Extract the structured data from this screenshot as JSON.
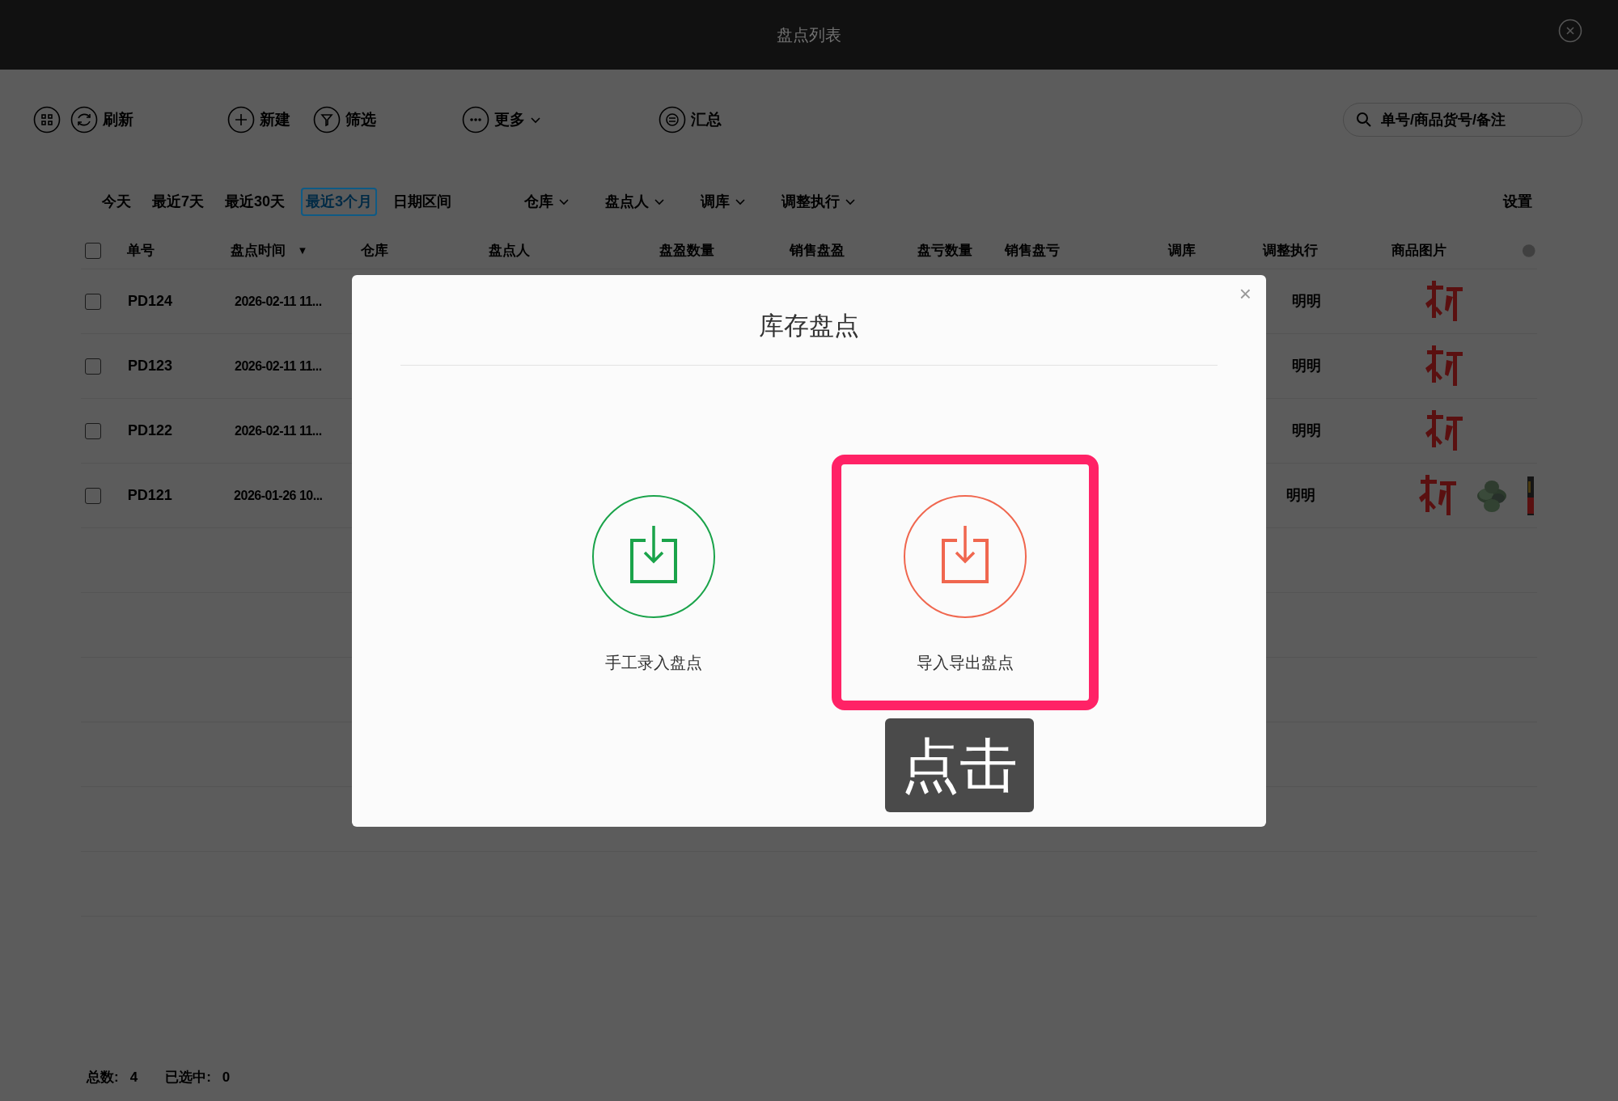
{
  "window": {
    "title": "盘点列表"
  },
  "toolbar": [
    {
      "dropdown": false
    },
    {
      "label": "刷新",
      "dropdown": false
    },
    {
      "label": "新建",
      "dropdown": false
    },
    {
      "label": "筛选",
      "dropdown": false
    },
    {
      "label": "更多",
      "dropdown": true
    },
    {
      "label": "汇总",
      "dropdown": false
    }
  ],
  "search": {
    "placeholder": "单号/商品货号/备注"
  },
  "date_filters": [
    {
      "label": "今天",
      "selected": false
    },
    {
      "label": "最近7天",
      "selected": false
    },
    {
      "label": "最近30天",
      "selected": false
    },
    {
      "label": "最近3个月",
      "selected": true
    },
    {
      "label": "日期区间",
      "selected": false
    }
  ],
  "dropdown_filters": [
    "仓库",
    "盘点人",
    "调库",
    "调整执行"
  ],
  "settings_link": "设置",
  "table": {
    "select_all": {
      "checked": false
    },
    "columns": [
      {
        "label": "单号"
      },
      {
        "label": "盘点时间",
        "sort": "▼"
      },
      {
        "label": "仓库"
      },
      {
        "label": "盘点人"
      },
      {
        "label": "盘盈数量"
      },
      {
        "label": "销售盘盈"
      },
      {
        "label": "盘亏数量"
      },
      {
        "label": "销售盘亏"
      },
      {
        "label": "调库"
      },
      {
        "label": "调整执行"
      },
      {
        "label": "商品图片"
      }
    ],
    "rows": [
      {
        "checked": false,
        "id": "PD124",
        "time": "2026-02-11 11...",
        "executor": "明明"
      },
      {
        "checked": false,
        "id": "PD123",
        "time": "2026-02-11 11...",
        "executor": "明明"
      },
      {
        "checked": false,
        "id": "PD122",
        "time": "2026-02-11 11...",
        "executor": "明明"
      },
      {
        "checked": false,
        "id": "PD121",
        "time": "2026-01-26 10...",
        "executor": "明明"
      }
    ]
  },
  "status_bar": {
    "total_label": "总数:",
    "total": "4",
    "selected_label": "已选中:",
    "selected": "0"
  },
  "dialog": {
    "title": "库存盘点",
    "close": "×",
    "options": [
      {
        "label": "手工录入盘点",
        "color": "#1aa34a",
        "highlighted": false
      },
      {
        "label": "导入导出盘点",
        "color": "#f0674f",
        "highlighted": true
      }
    ],
    "callout": "点击"
  }
}
